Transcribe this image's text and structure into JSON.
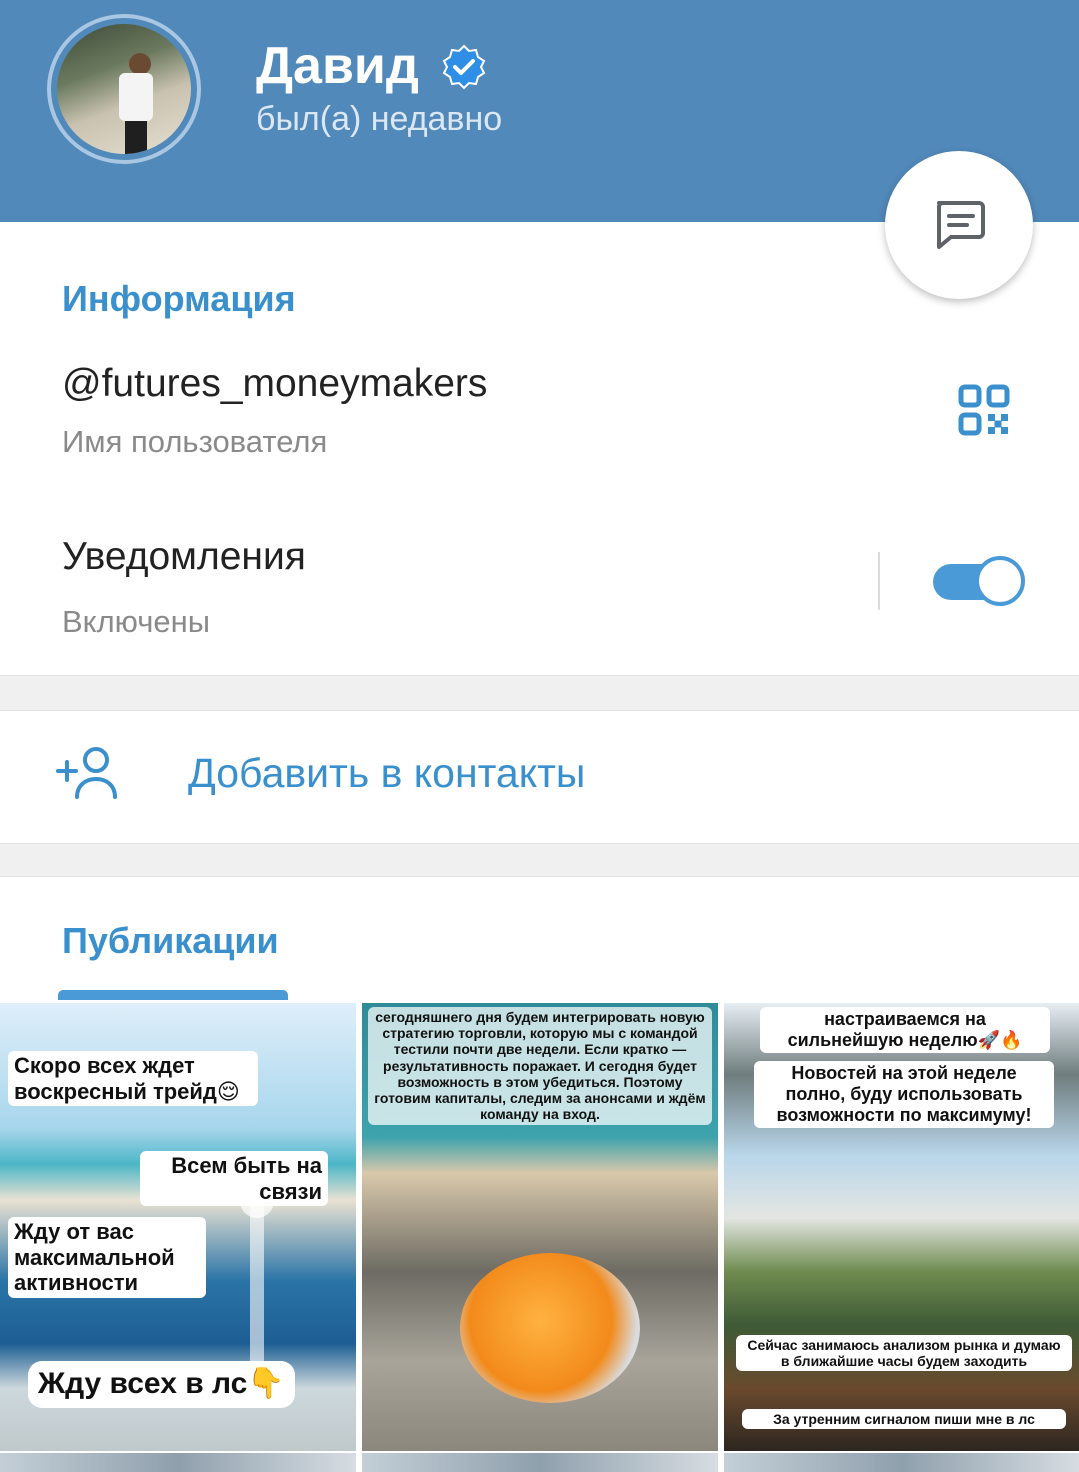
{
  "header": {
    "name": "Давид",
    "status": "был(а) недавно",
    "background_color": "#5189ba",
    "verified_icon": "verified-badge-icon",
    "avatar_icon": "avatar-photo"
  },
  "fab": {
    "icon": "message-icon"
  },
  "info": {
    "title": "Информация",
    "username": "@futures_moneymakers",
    "username_label": "Имя пользователя",
    "qr_icon": "qr-code-icon",
    "notifications_label": "Уведомления",
    "notifications_value": "Включены",
    "notifications_on": true,
    "accent_color": "#3a8fcd"
  },
  "add_contact": {
    "label": "Добавить в контакты",
    "icon": "add-person-icon"
  },
  "publications": {
    "title": "Публикации",
    "tiles": [
      {
        "captions": [
          "Скоро всех ждет воскресный трейд😌",
          "Всем быть на связи",
          "Жду от вас максимальной активности",
          "Жду всех в лс👇"
        ]
      },
      {
        "captions": [
          "сегодняшнего дня будем интегрировать новую стратегию торговли, которую мы с командой тестили почти две недели. Если кратко — результативность поражает. И сегодня будет возможность в этом убедиться. Поэтому готовим капиталы, следим за анонсами и ждём команду на вход."
        ]
      },
      {
        "captions": [
          "настраиваемся на сильнейшую неделю🚀🔥",
          "Новостей на этой неделе полно, буду использовать возможности по максимуму!",
          "Сейчас занимаюсь анализом рынка и думаю в ближайшие часы будем заходить",
          "За утренним сигналом пиши мне в лс"
        ]
      }
    ]
  }
}
